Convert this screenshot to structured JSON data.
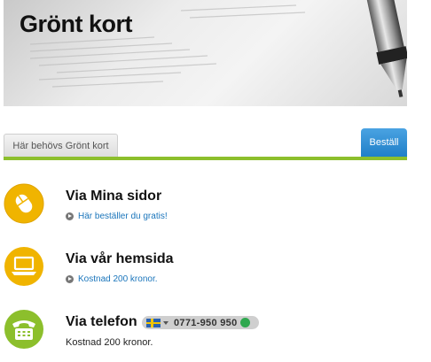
{
  "hero": {
    "title": "Grönt kort"
  },
  "tabs": {
    "left_label": "Här behövs Grönt kort",
    "right_label": "Beställ"
  },
  "options": [
    {
      "title": "Via Mina sidor",
      "subtitle": "Här beställer du gratis!",
      "icon": "mouse-icon",
      "color": "#f0b400"
    },
    {
      "title": "Via vår hemsida",
      "subtitle": "Kostnad 200 kronor.",
      "icon": "laptop-icon",
      "color": "#f0b400"
    },
    {
      "title": "Via telefon",
      "subtitle": "Kostnad 200 kronor.",
      "icon": "telephone-icon",
      "color": "#8cbf2c",
      "phone_number": "0771-950 950"
    }
  ],
  "colors": {
    "accent_green": "#8cbf2c",
    "tab_blue": "#1f7fc8",
    "link_blue": "#1a75bb",
    "icon_yellow": "#f0b400"
  }
}
